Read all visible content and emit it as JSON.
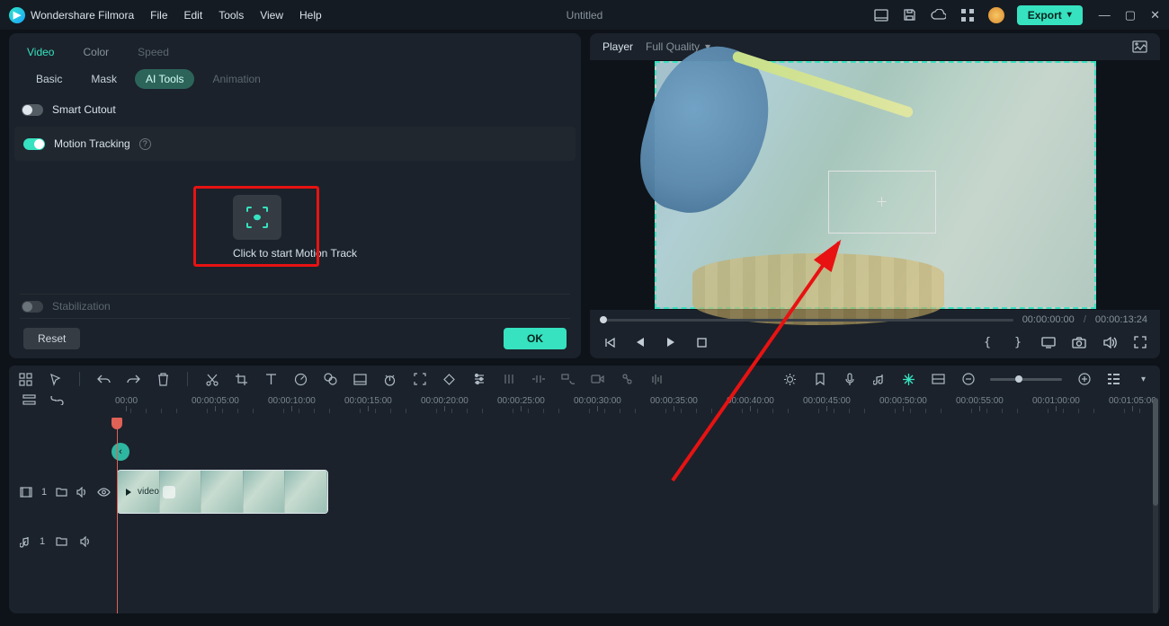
{
  "app": {
    "name": "Wondershare Filmora"
  },
  "menu": {
    "file": "File",
    "edit": "Edit",
    "tools": "Tools",
    "view": "View",
    "help": "Help"
  },
  "document": {
    "title": "Untitled"
  },
  "export": {
    "label": "Export"
  },
  "inspector": {
    "tabs": {
      "video": "Video",
      "color": "Color",
      "speed": "Speed"
    },
    "subtabs": {
      "basic": "Basic",
      "mask": "Mask",
      "ai_tools": "AI Tools",
      "animation": "Animation"
    },
    "smart_cutout": {
      "label": "Smart Cutout"
    },
    "motion_tracking": {
      "label": "Motion Tracking"
    },
    "motion_track_button_caption": "Click to start Motion Track",
    "stabilization": {
      "label": "Stabilization"
    },
    "reset": "Reset",
    "ok": "OK"
  },
  "player": {
    "label": "Player",
    "quality": "Full Quality",
    "current_time": "00:00:00:00",
    "total_time": "00:00:13:24"
  },
  "timeline": {
    "ruler": [
      "00:00",
      "00:00:05:00",
      "00:00:10:00",
      "00:00:15:00",
      "00:00:20:00",
      "00:00:25:00",
      "00:00:30:00",
      "00:00:35:00",
      "00:00:40:00",
      "00:00:45:00",
      "00:00:50:00",
      "00:00:55:00",
      "00:01:00:00",
      "00:01:05:00"
    ],
    "video_track": {
      "num": "1"
    },
    "audio_track": {
      "num": "1"
    },
    "clip": {
      "name": "video"
    }
  }
}
